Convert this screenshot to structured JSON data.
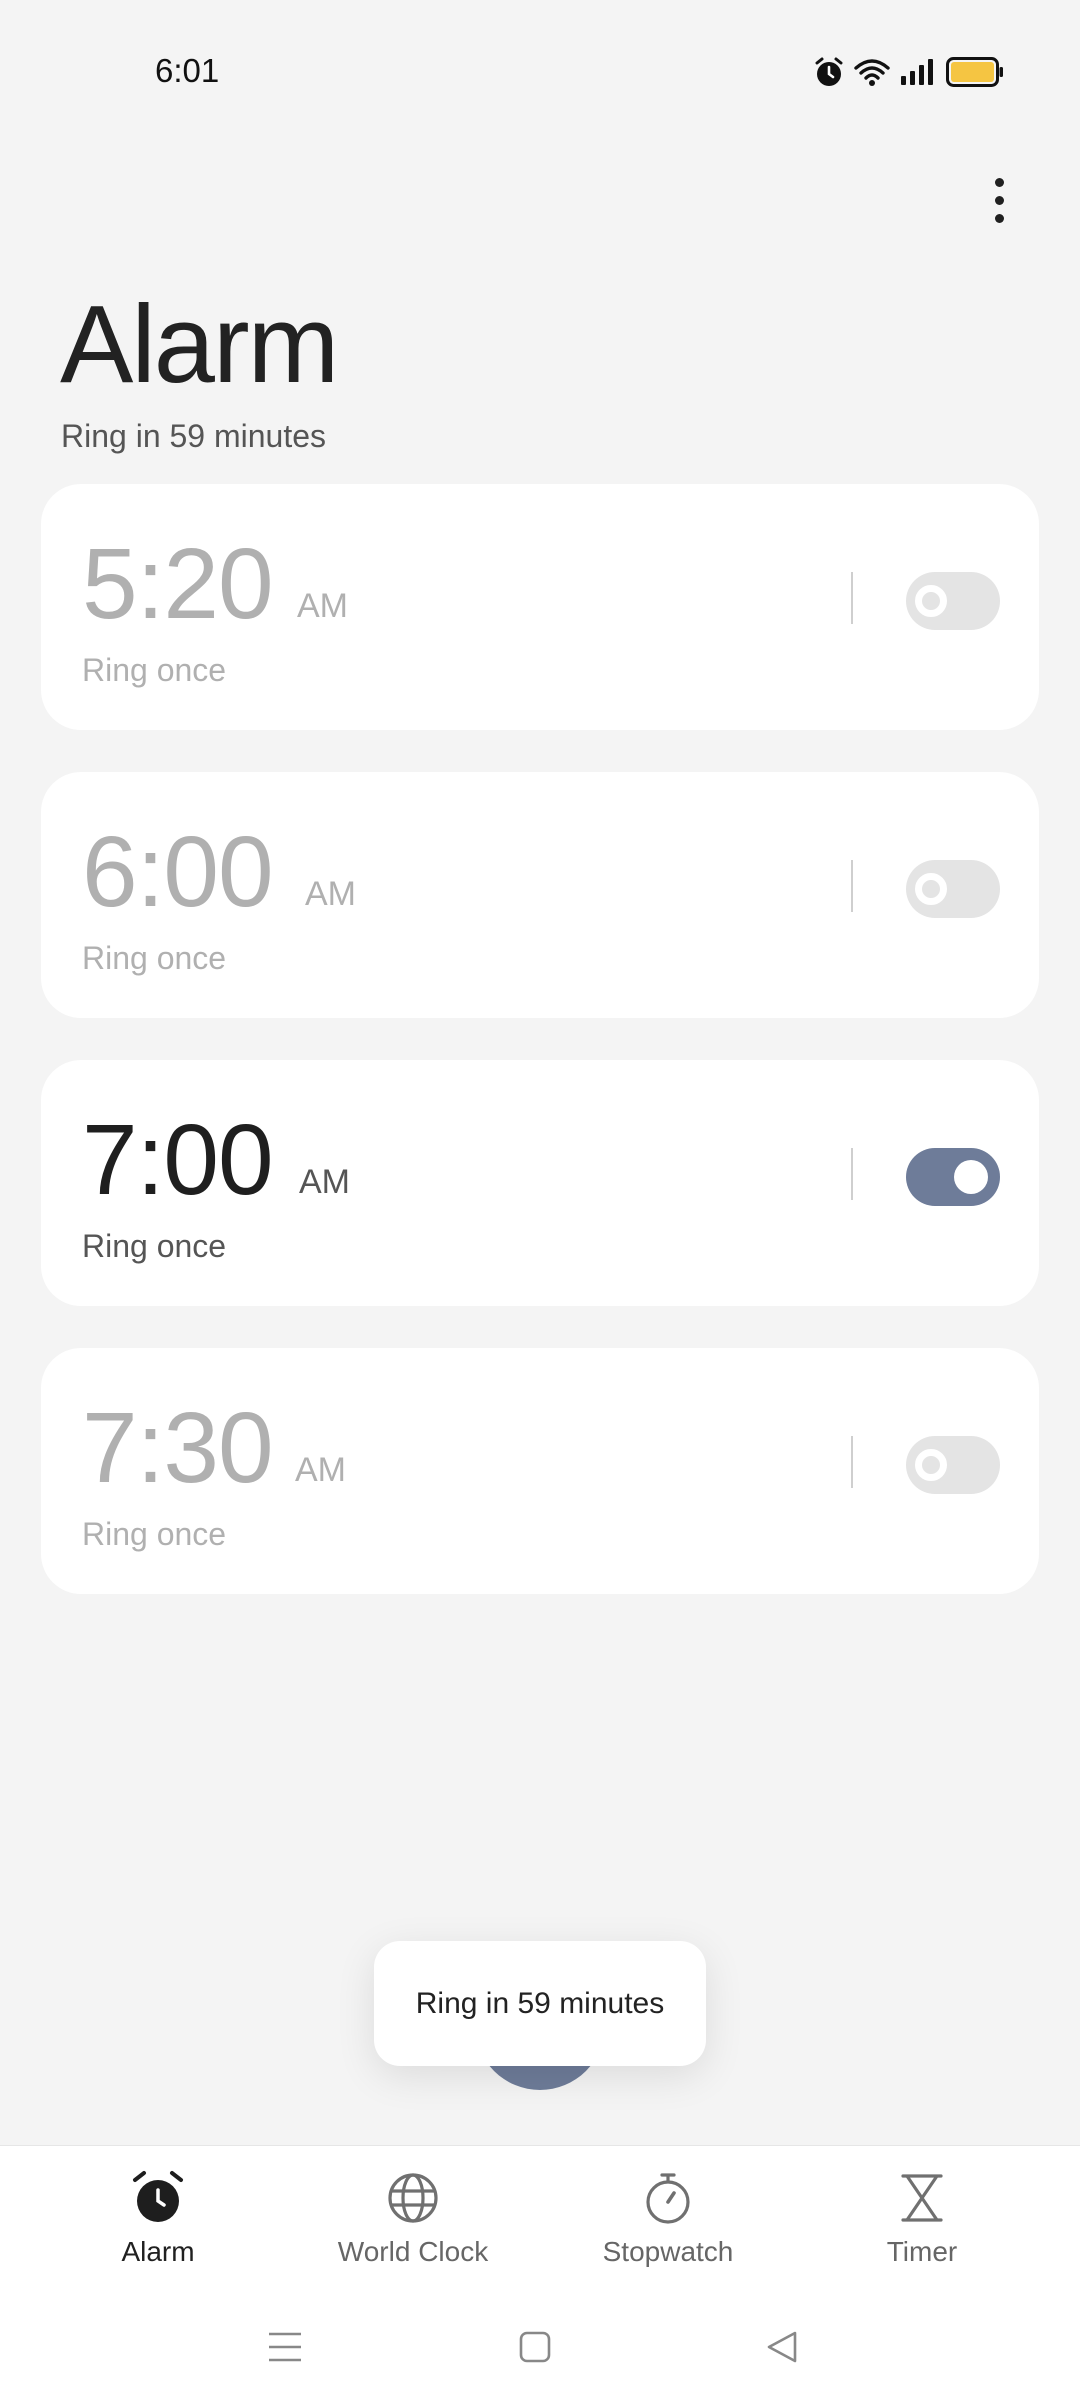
{
  "status_bar": {
    "time": "6:01",
    "icons": [
      "alarm-icon",
      "wifi-icon",
      "signal-icon",
      "battery-icon"
    ],
    "battery_color": "#f5c542"
  },
  "header": {
    "title": "Alarm",
    "subtitle": "Ring in 59 minutes",
    "more_icon": "more-vertical-icon"
  },
  "alarms": [
    {
      "time": "5:20",
      "ampm": "AM",
      "repeat": "Ring once",
      "enabled": false
    },
    {
      "time": "6:00",
      "ampm": "AM",
      "repeat": "Ring once",
      "enabled": false
    },
    {
      "time": "7:00",
      "ampm": "AM",
      "repeat": "Ring once",
      "enabled": true
    },
    {
      "time": "7:30",
      "ampm": "AM",
      "repeat": "Ring once",
      "enabled": false
    }
  ],
  "toast": {
    "text": "Ring in 59 minutes"
  },
  "bottom_nav": {
    "items": [
      {
        "label": "Alarm",
        "icon": "alarm-clock-icon",
        "active": true
      },
      {
        "label": "World Clock",
        "icon": "globe-icon",
        "active": false
      },
      {
        "label": "Stopwatch",
        "icon": "stopwatch-icon",
        "active": false
      },
      {
        "label": "Timer",
        "icon": "hourglass-icon",
        "active": false
      }
    ]
  },
  "system_nav": {
    "icons": [
      "menu-icon",
      "home-icon",
      "back-icon"
    ]
  },
  "colors": {
    "accent": "#6e7c99",
    "background": "#f4f4f4",
    "card": "#ffffff",
    "disabled_text": "#b0b0b0"
  }
}
